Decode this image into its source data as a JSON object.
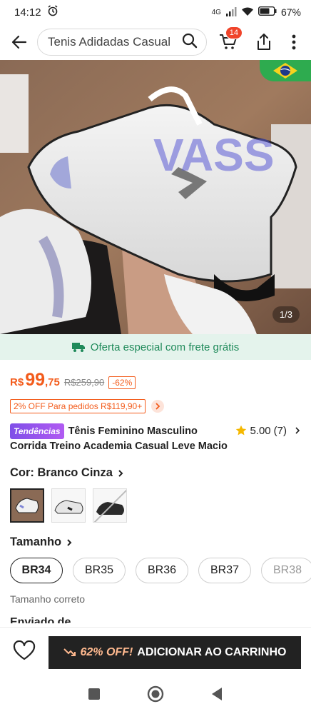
{
  "status_bar": {
    "time": "14:12",
    "network": "4G",
    "battery": "67%"
  },
  "header": {
    "search_text": "Tenis Adidadas Casual",
    "cart_count": "14"
  },
  "hero": {
    "counter": "1/3",
    "watermark": "VASS"
  },
  "shipping_banner": {
    "text": "Oferta especial com frete grátis"
  },
  "price": {
    "currency": "R$",
    "integer": "99",
    "decimals": ",75",
    "original": "R$259,90",
    "discount": "-62%"
  },
  "promo": {
    "text": "2% OFF Para pedidos R$119,90+"
  },
  "product": {
    "badge": "Tendências",
    "title": "Tênis Feminino Masculino Corrida Treino Academia Casual Leve Macio",
    "rating": "5.00",
    "reviews": "(7)"
  },
  "color": {
    "label": "Cor: Branco Cinza"
  },
  "size": {
    "label": "Tamanho",
    "options": [
      "BR34",
      "BR35",
      "BR36",
      "BR37",
      "BR38"
    ],
    "fit_note": "Tamanho correto"
  },
  "shipped_from": {
    "label": "Enviado de"
  },
  "bottom": {
    "cta_off": "62% OFF!",
    "cta_text": "ADICIONAR AO CARRINHO"
  },
  "colors": {
    "accent": "#f35c1c",
    "green": "#1f8a5a",
    "dark": "#222222",
    "badge_red": "#f0442a"
  }
}
